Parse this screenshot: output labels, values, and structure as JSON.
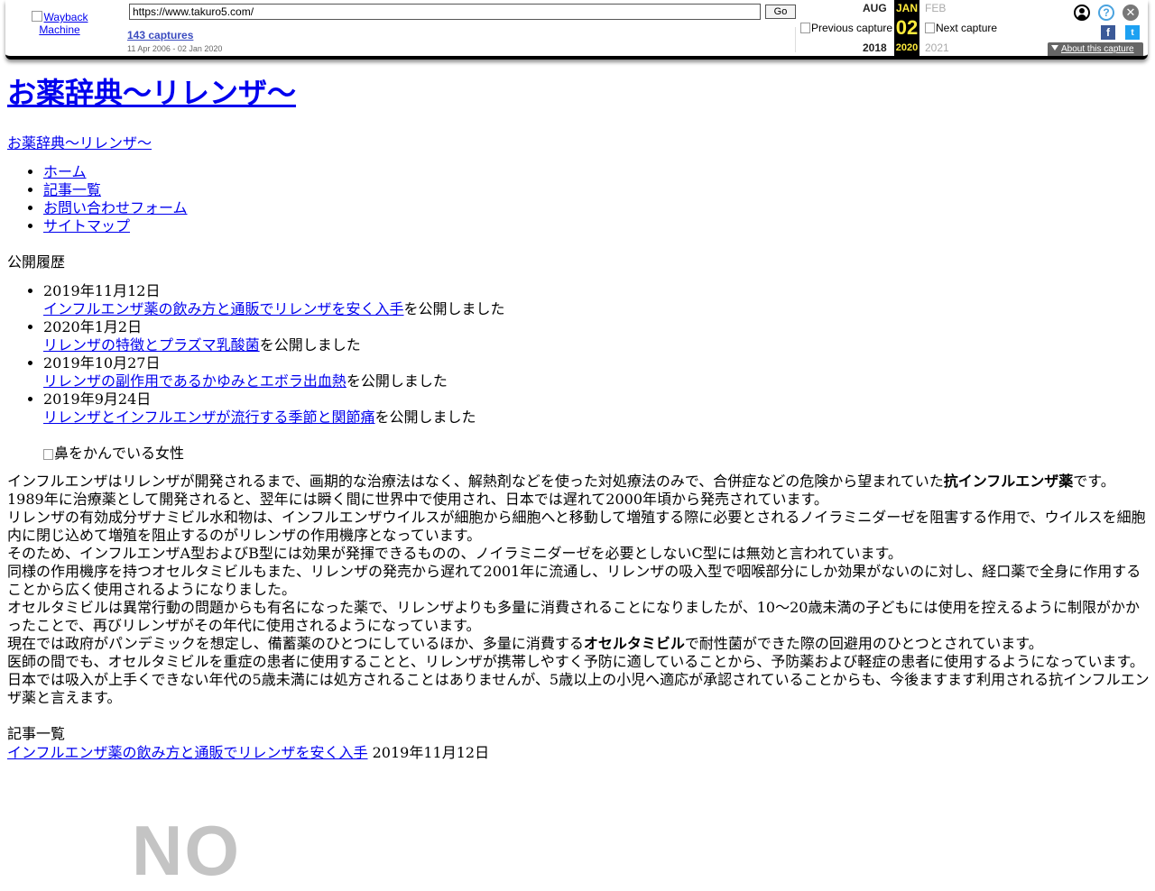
{
  "toolbar": {
    "logo_alt": "Wayback Machine",
    "url": "https://www.takuro5.com/",
    "go_label": "Go",
    "captures_label": "143 captures",
    "range_label": "11 Apr 2006 - 02 Jan 2020",
    "prev_label": "Previous capture",
    "next_label": "Next capture",
    "months": {
      "prev": "AUG",
      "current": "JAN",
      "next": "FEB"
    },
    "day": "02",
    "years": {
      "prev": "2018",
      "current": "2020",
      "next": "2021"
    },
    "about_label": "About this capture",
    "icons": [
      "user-icon",
      "help-icon",
      "close-icon",
      "facebook-icon",
      "twitter-icon"
    ]
  },
  "site": {
    "title": "お薬辞典～リレンザ～",
    "subtitle_link": "お薬辞典～リレンザ～"
  },
  "nav": [
    "ホーム",
    "記事一覧",
    "お問い合わせフォーム",
    "サイトマップ"
  ],
  "history": {
    "label": "公開履歴",
    "suffix": "を公開しました",
    "items": [
      {
        "date": "2019年11月12日",
        "link": "インフルエンザ薬の飲み方と通販でリレンザを安く入手"
      },
      {
        "date": "2020年1月2日",
        "link": "リレンザの特徴とプラズマ乳酸菌"
      },
      {
        "date": "2019年10月27日",
        "link": "リレンザの副作用であるかゆみとエボラ出血熱"
      },
      {
        "date": "2019年9月24日",
        "link": "リレンザとインフルエンザが流行する季節と関節痛"
      }
    ]
  },
  "image_alt": "鼻をかんでいる女性",
  "article": {
    "p1_a": "インフルエンザはリレンザが開発されるまで、画期的な治療法はなく、解熱剤などを使った対処療法のみで、合併症などの危険から望まれていた",
    "p1_bold": "抗インフルエンザ薬",
    "p1_b": "です。",
    "p2": "1989年に治療薬として開発されると、翌年には瞬く間に世界中で使用され、日本では遅れて2000年頃から発売されています。",
    "p3": "リレンザの有効成分ザナミビル水和物は、インフルエンザウイルスが細胞から細胞へと移動して増殖する際に必要とされるノイラミニダーゼを阻害する作用で、ウイルスを細胞内に閉じ込めて増殖を阻止するのがリレンザの作用機序となっています。",
    "p4": "そのため、インフルエンザA型およびB型には効果が発揮できるものの、ノイラミニダーゼを必要としないC型には無効と言われています。",
    "p5": "同様の作用機序を持つオセルタミビルもまた、リレンザの発売から遅れて2001年に流通し、リレンザの吸入型で咽喉部分にしか効果がないのに対し、経口薬で全身に作用することから広く使用されるようになりました。",
    "p6": "オセルタミビルは異常行動の問題からも有名になった薬で、リレンザよりも多量に消費されることになりましたが、10～20歳未満の子どもには使用を控えるように制限がかかったことで、再びリレンザがその年代に使用されるようになっています。",
    "p7_a": "現在では政府がパンデミックを想定し、備蓄薬のひとつにしているほか、多量に消費する",
    "p7_bold": "オセルタミビル",
    "p7_b": "で耐性菌ができた際の回避用のひとつとされています。",
    "p8": "医師の間でも、オセルタミビルを重症の患者に使用することと、リレンザが携帯しやすく予防に適していることから、予防薬および軽症の患者に使用するようになっています。",
    "p9": "日本では吸入が上手くできない年代の5歳未満には処方されることはありませんが、5歳以上の小児へ適応が承認されていることからも、今後ますます利用される抗インフルエンザ薬と言えます。"
  },
  "article_list": {
    "label": "記事一覧",
    "items": [
      {
        "link": "インフルエンザ薬の飲み方と通販でリレンザを安く入手",
        "date": "2019年11月12日"
      }
    ]
  },
  "noimage_text": "NO"
}
